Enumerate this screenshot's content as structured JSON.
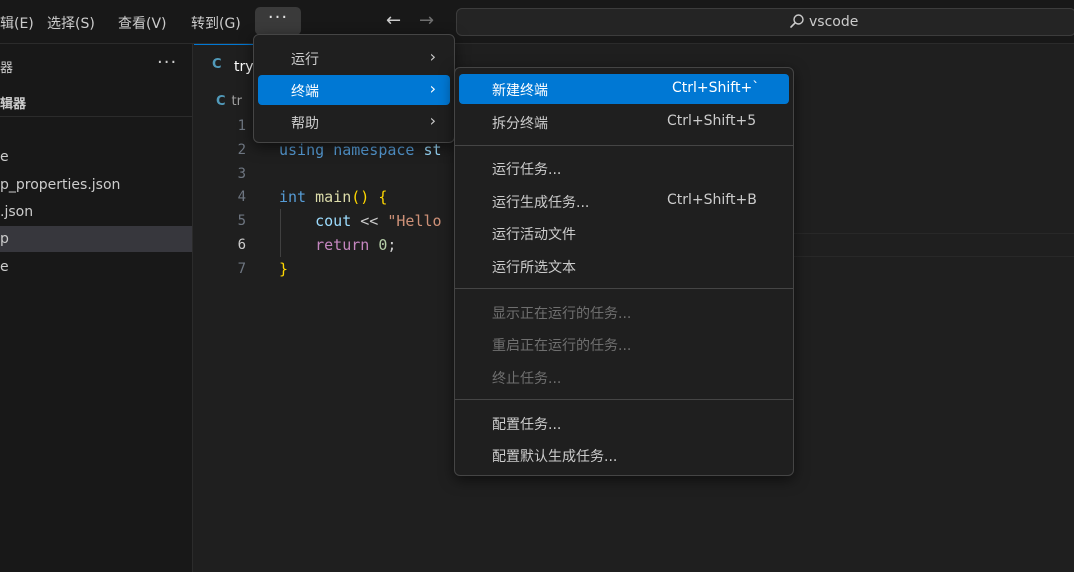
{
  "menubar": {
    "items": [
      "辑(E)",
      "选择(S)",
      "查看(V)",
      "转到(G)"
    ],
    "more_label": "···"
  },
  "nav": {
    "back": "←",
    "forward": "→"
  },
  "search": {
    "text": "vscode"
  },
  "sidebar": {
    "header": "器",
    "header_more": "···",
    "section": "辑器",
    "files": [
      "e",
      "p_properties.json",
      ".json",
      "p",
      "e"
    ]
  },
  "editor": {
    "tab": {
      "icon": "C",
      "label": "try"
    },
    "breadcrumb": {
      "icon": "C",
      "label": "tr"
    },
    "line_numbers": [
      "1",
      "2",
      "3",
      "4",
      "5",
      "6",
      "7"
    ]
  },
  "main_menu": {
    "items": [
      {
        "label": "运行",
        "chevron": "›"
      },
      {
        "label": "终端",
        "chevron": "›"
      },
      {
        "label": "帮助",
        "chevron": "›"
      }
    ]
  },
  "terminal_menu": {
    "items": [
      {
        "label": "新建终端",
        "shortcut": "Ctrl+Shift+`"
      },
      {
        "label": "拆分终端",
        "shortcut": "Ctrl+Shift+5"
      },
      {
        "label": "运行任务...",
        "shortcut": ""
      },
      {
        "label": "运行生成任务...",
        "shortcut": "Ctrl+Shift+B"
      },
      {
        "label": "运行活动文件",
        "shortcut": ""
      },
      {
        "label": "运行所选文本",
        "shortcut": ""
      },
      {
        "label": "显示正在运行的任务...",
        "shortcut": ""
      },
      {
        "label": "重启正在运行的任务...",
        "shortcut": ""
      },
      {
        "label": "终止任务...",
        "shortcut": ""
      },
      {
        "label": "配置任务...",
        "shortcut": ""
      },
      {
        "label": "配置默认生成任务...",
        "shortcut": ""
      }
    ]
  },
  "colors": {
    "accent": "#0078d4",
    "background": "#1f1f1f",
    "menu_background": "#1f1f1f",
    "disabled_text": "#6f6f6f"
  }
}
